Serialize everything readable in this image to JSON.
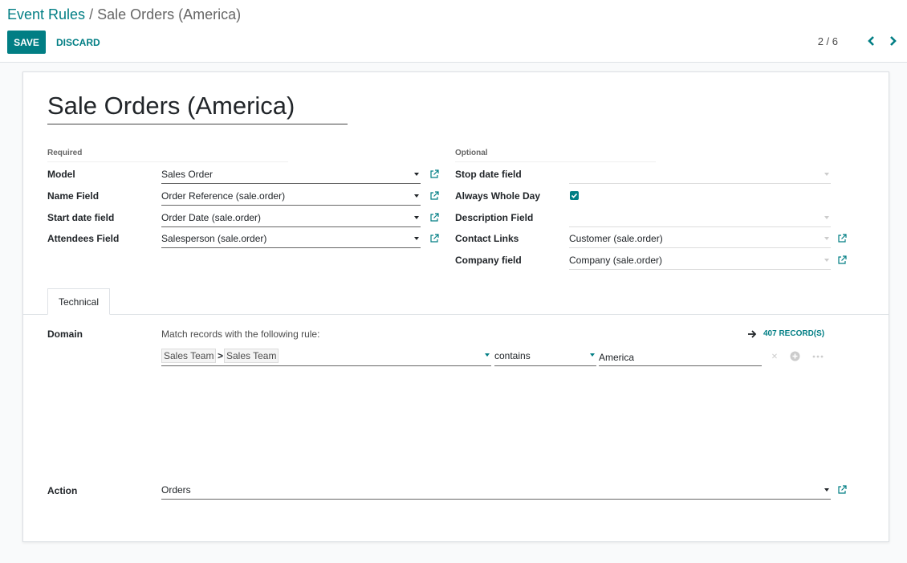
{
  "breadcrumb": {
    "parent": "Event Rules",
    "separator": "/",
    "current": "Sale Orders (America)"
  },
  "toolbar": {
    "save_label": "SAVE",
    "discard_label": "DISCARD"
  },
  "pager": {
    "value": "2 / 6"
  },
  "record": {
    "title": "Sale Orders (America)",
    "required": {
      "group_label": "Required",
      "model_label": "Model",
      "model_value": "Sales Order",
      "name_field_label": "Name Field",
      "name_field_value": "Order Reference (sale.order)",
      "start_date_label": "Start date field",
      "start_date_value": "Order Date (sale.order)",
      "attendees_label": "Attendees Field",
      "attendees_value": "Salesperson (sale.order)"
    },
    "optional": {
      "group_label": "Optional",
      "stop_date_label": "Stop date field",
      "stop_date_value": "",
      "whole_day_label": "Always Whole Day",
      "whole_day_checked": true,
      "description_label": "Description Field",
      "description_value": "",
      "contact_links_label": "Contact Links",
      "contact_links_value": "Customer (sale.order)",
      "company_label": "Company field",
      "company_value": "Company (sale.order)"
    }
  },
  "notebook": {
    "tabs": [
      {
        "label": "Technical"
      }
    ],
    "domain": {
      "label": "Domain",
      "rule_text": "Match records with the following rule:",
      "records_label": "407 RECORD(S)",
      "path": [
        "Sales Team",
        "Sales Team"
      ],
      "path_separator": ">",
      "operator": "contains",
      "value": "America"
    },
    "action": {
      "label": "Action",
      "value": "Orders"
    }
  },
  "colors": {
    "accent": "#017e84",
    "text": "#212529"
  }
}
